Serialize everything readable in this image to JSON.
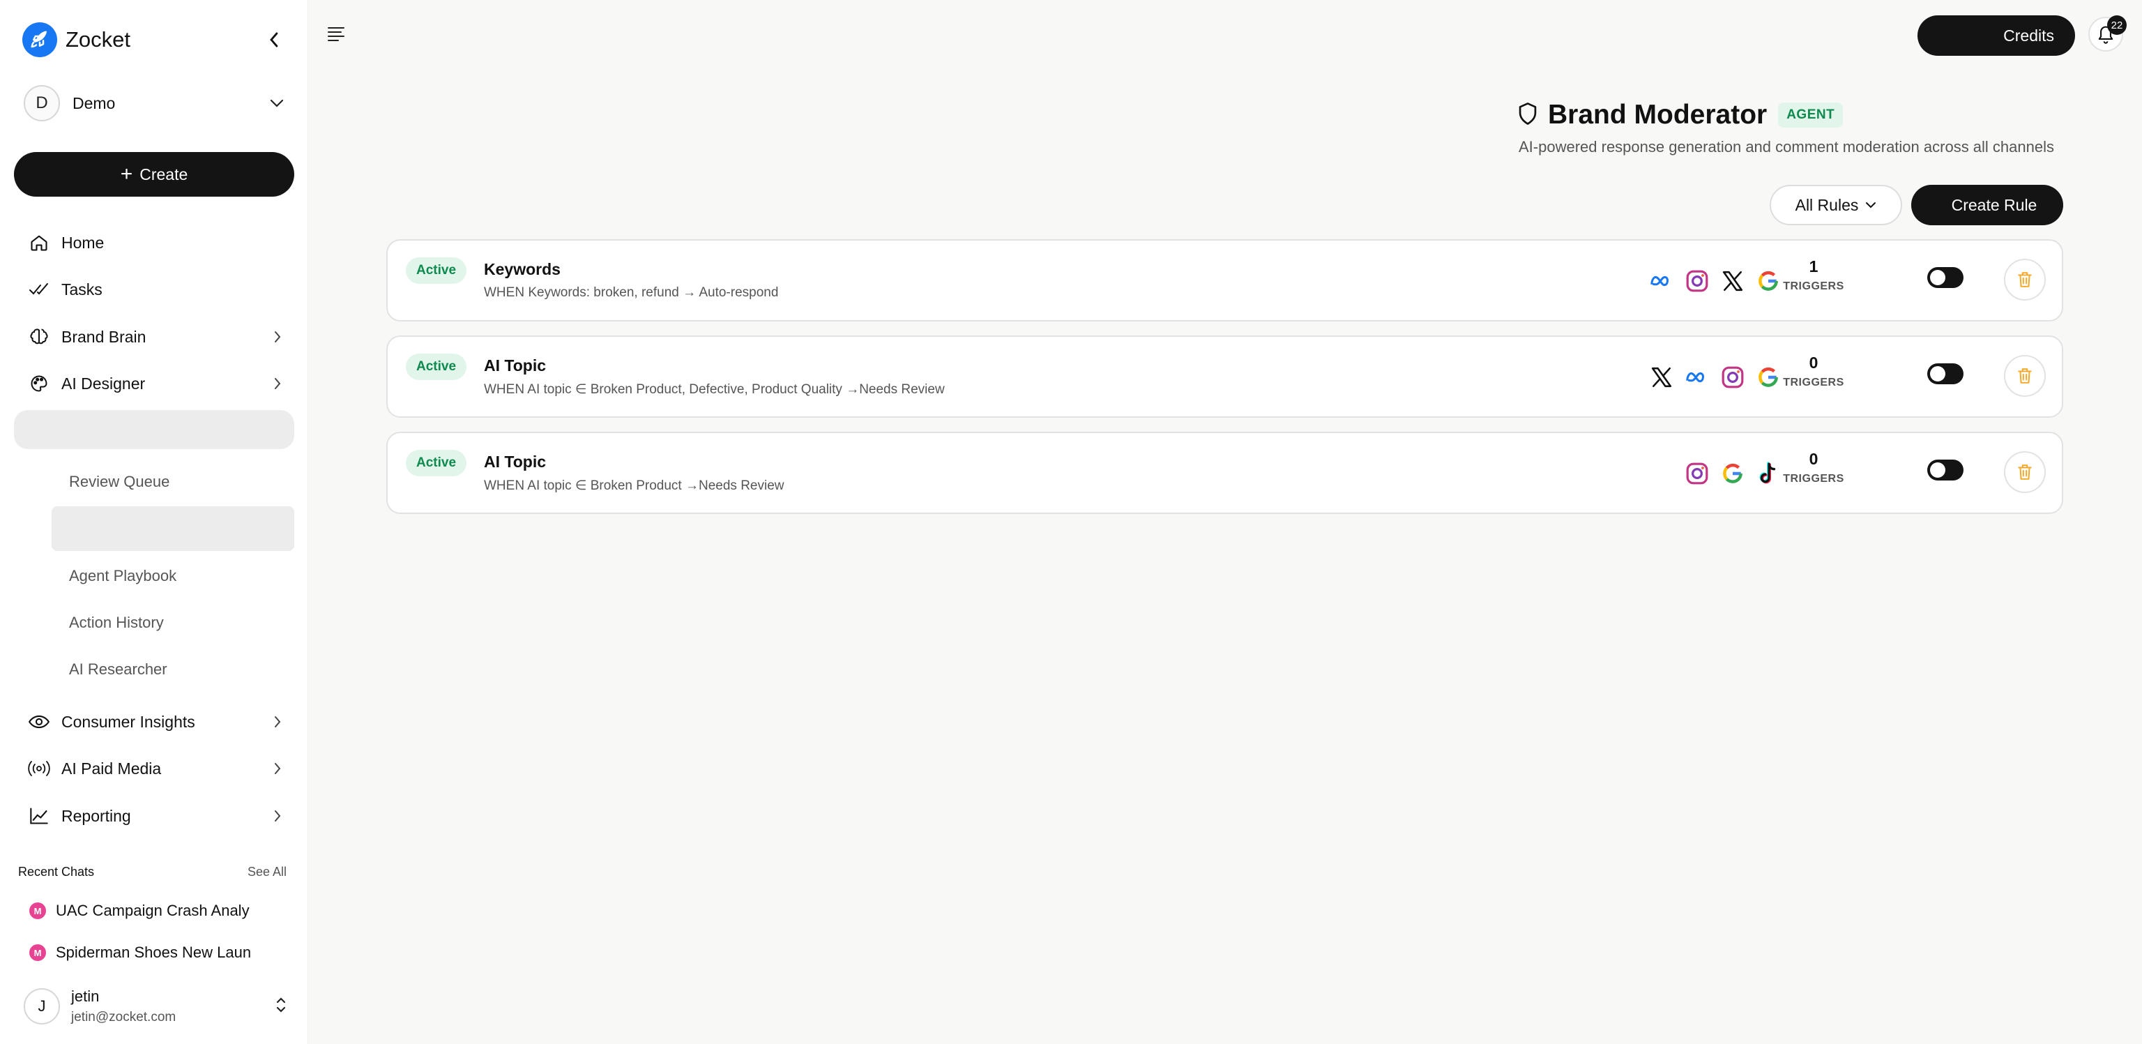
{
  "sidebar": {
    "brand": "Zocket",
    "workspace": {
      "initial": "D",
      "name": "Demo"
    },
    "create_label": "Create",
    "nav": [
      {
        "label": "Home",
        "icon": "home-icon"
      },
      {
        "label": "Tasks",
        "icon": "tasks-icon"
      },
      {
        "label": "Brand Brain",
        "icon": "brain-icon"
      },
      {
        "label": "AI Designer",
        "icon": "palette-icon"
      },
      {
        "label": "Consumer Insights",
        "icon": "eye-icon"
      },
      {
        "label": "AI Paid Media",
        "icon": "broadcast-icon"
      },
      {
        "label": "Reporting",
        "icon": "chart-line-icon"
      }
    ],
    "sub_items": [
      "Review Queue",
      "Agent Playbook",
      "Action History",
      "AI Researcher"
    ],
    "recent_label": "Recent Chats",
    "see_all": "See All",
    "recent_chats": [
      {
        "badge": "M",
        "title": "UAC Campaign Crash Analy"
      },
      {
        "badge": "M",
        "title": "Spiderman Shoes New Laun"
      }
    ],
    "user": {
      "initial": "J",
      "name": "jetin",
      "email": "jetin@zocket.com"
    }
  },
  "topbar": {
    "credits_label": "Credits",
    "notif_count": "22"
  },
  "page": {
    "title": "Brand Moderator",
    "badge": "AGENT",
    "subtitle": "AI-powered response generation and comment moderation across all channels",
    "filter_label": "All Rules",
    "create_rule_label": "Create Rule"
  },
  "rules": [
    {
      "status": "Active",
      "name": "Keywords",
      "desc": "WHEN Keywords: broken, refund → Auto-respond",
      "platforms": [
        "meta",
        "instagram",
        "x",
        "google"
      ],
      "triggers": "1",
      "triggers_label": "TRIGGERS"
    },
    {
      "status": "Active",
      "name": "AI Topic",
      "desc": "WHEN AI topic ∈ Broken Product, Defective, Product Quality →Needs Review",
      "platforms": [
        "x",
        "meta",
        "instagram",
        "google"
      ],
      "triggers": "0",
      "triggers_label": "TRIGGERS"
    },
    {
      "status": "Active",
      "name": "AI Topic",
      "desc": "WHEN AI topic ∈ Broken Product →Needs Review",
      "platforms": [
        "instagram",
        "google",
        "tiktok"
      ],
      "triggers": "0",
      "triggers_label": "TRIGGERS"
    }
  ],
  "colors": {
    "accent_dark": "#141414",
    "brand_blue": "#1877f2",
    "active_green": "#0e8a4f",
    "active_bg": "#e1f5ea",
    "delete_orange": "#f5a623",
    "chat_badge": "#e84393"
  }
}
